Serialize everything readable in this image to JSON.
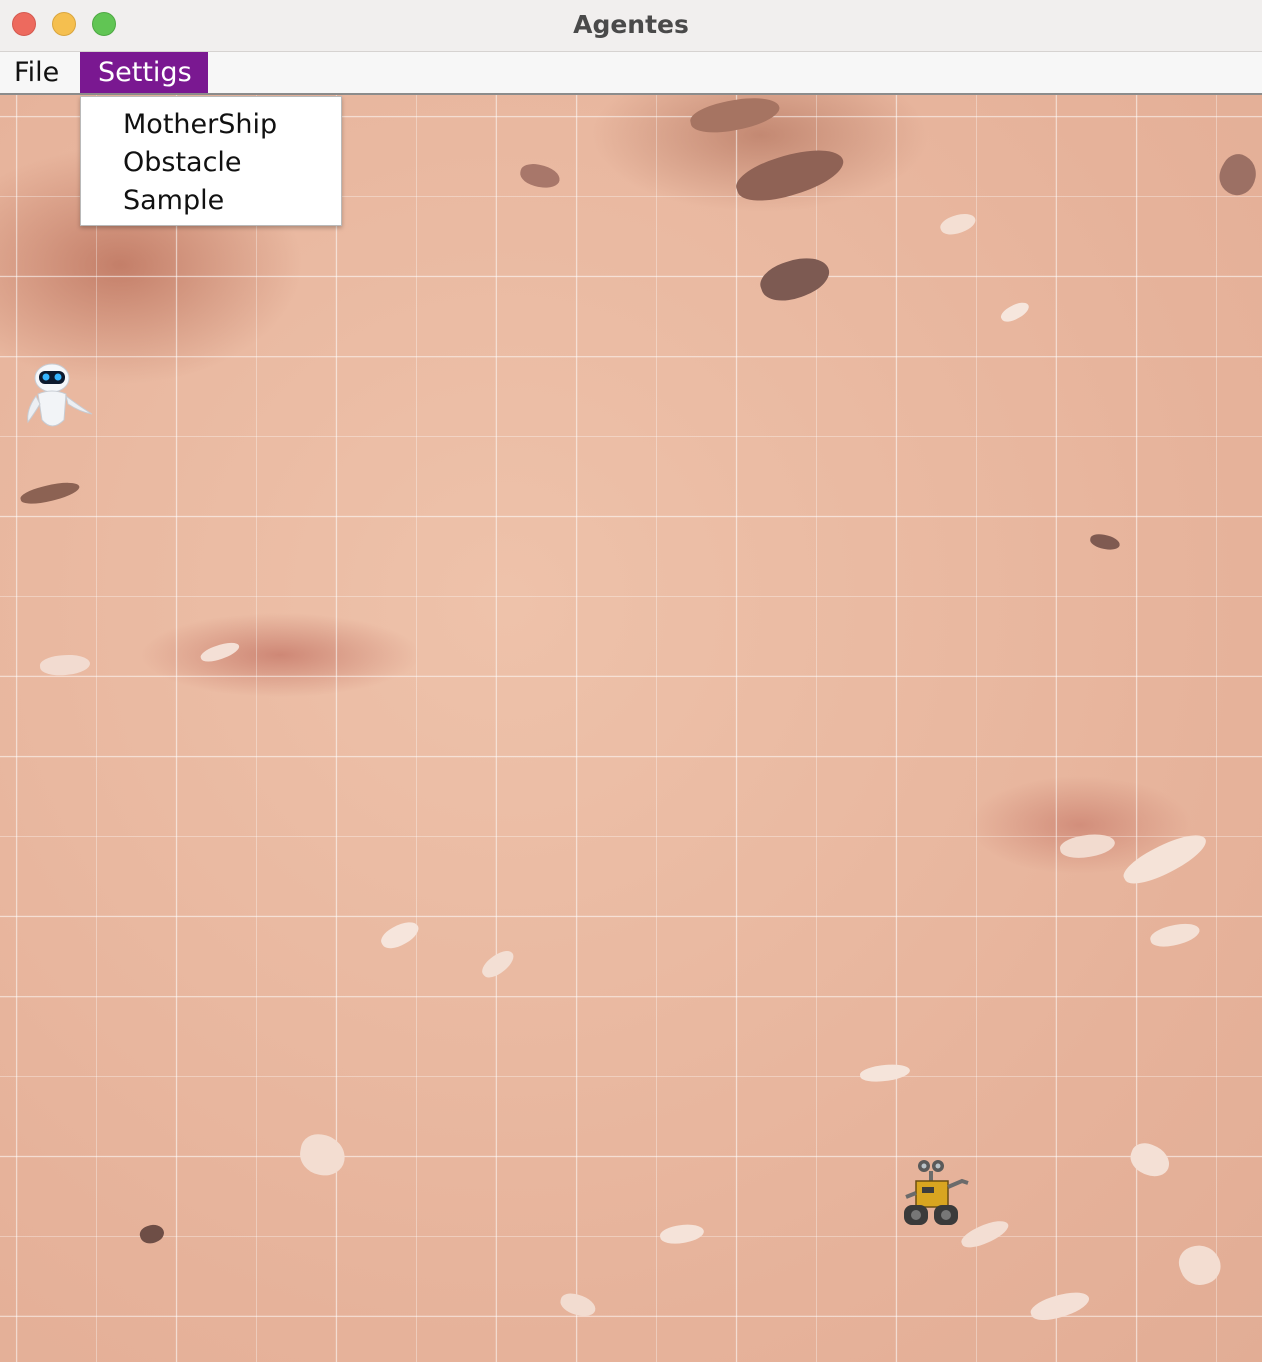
{
  "window": {
    "title": "Agentes"
  },
  "menubar": {
    "items": [
      {
        "label": "File"
      },
      {
        "label": "Settigs",
        "open": true
      }
    ]
  },
  "dropdown": {
    "items": [
      {
        "label": "MotherShip"
      },
      {
        "label": "Obstacle"
      },
      {
        "label": "Sample"
      }
    ]
  },
  "colors": {
    "menu_highlight": "#7a1891",
    "terrain": "#e9b8a0"
  },
  "agents": [
    {
      "name": "eve-robot-icon"
    },
    {
      "name": "walle-robot-icon"
    }
  ]
}
